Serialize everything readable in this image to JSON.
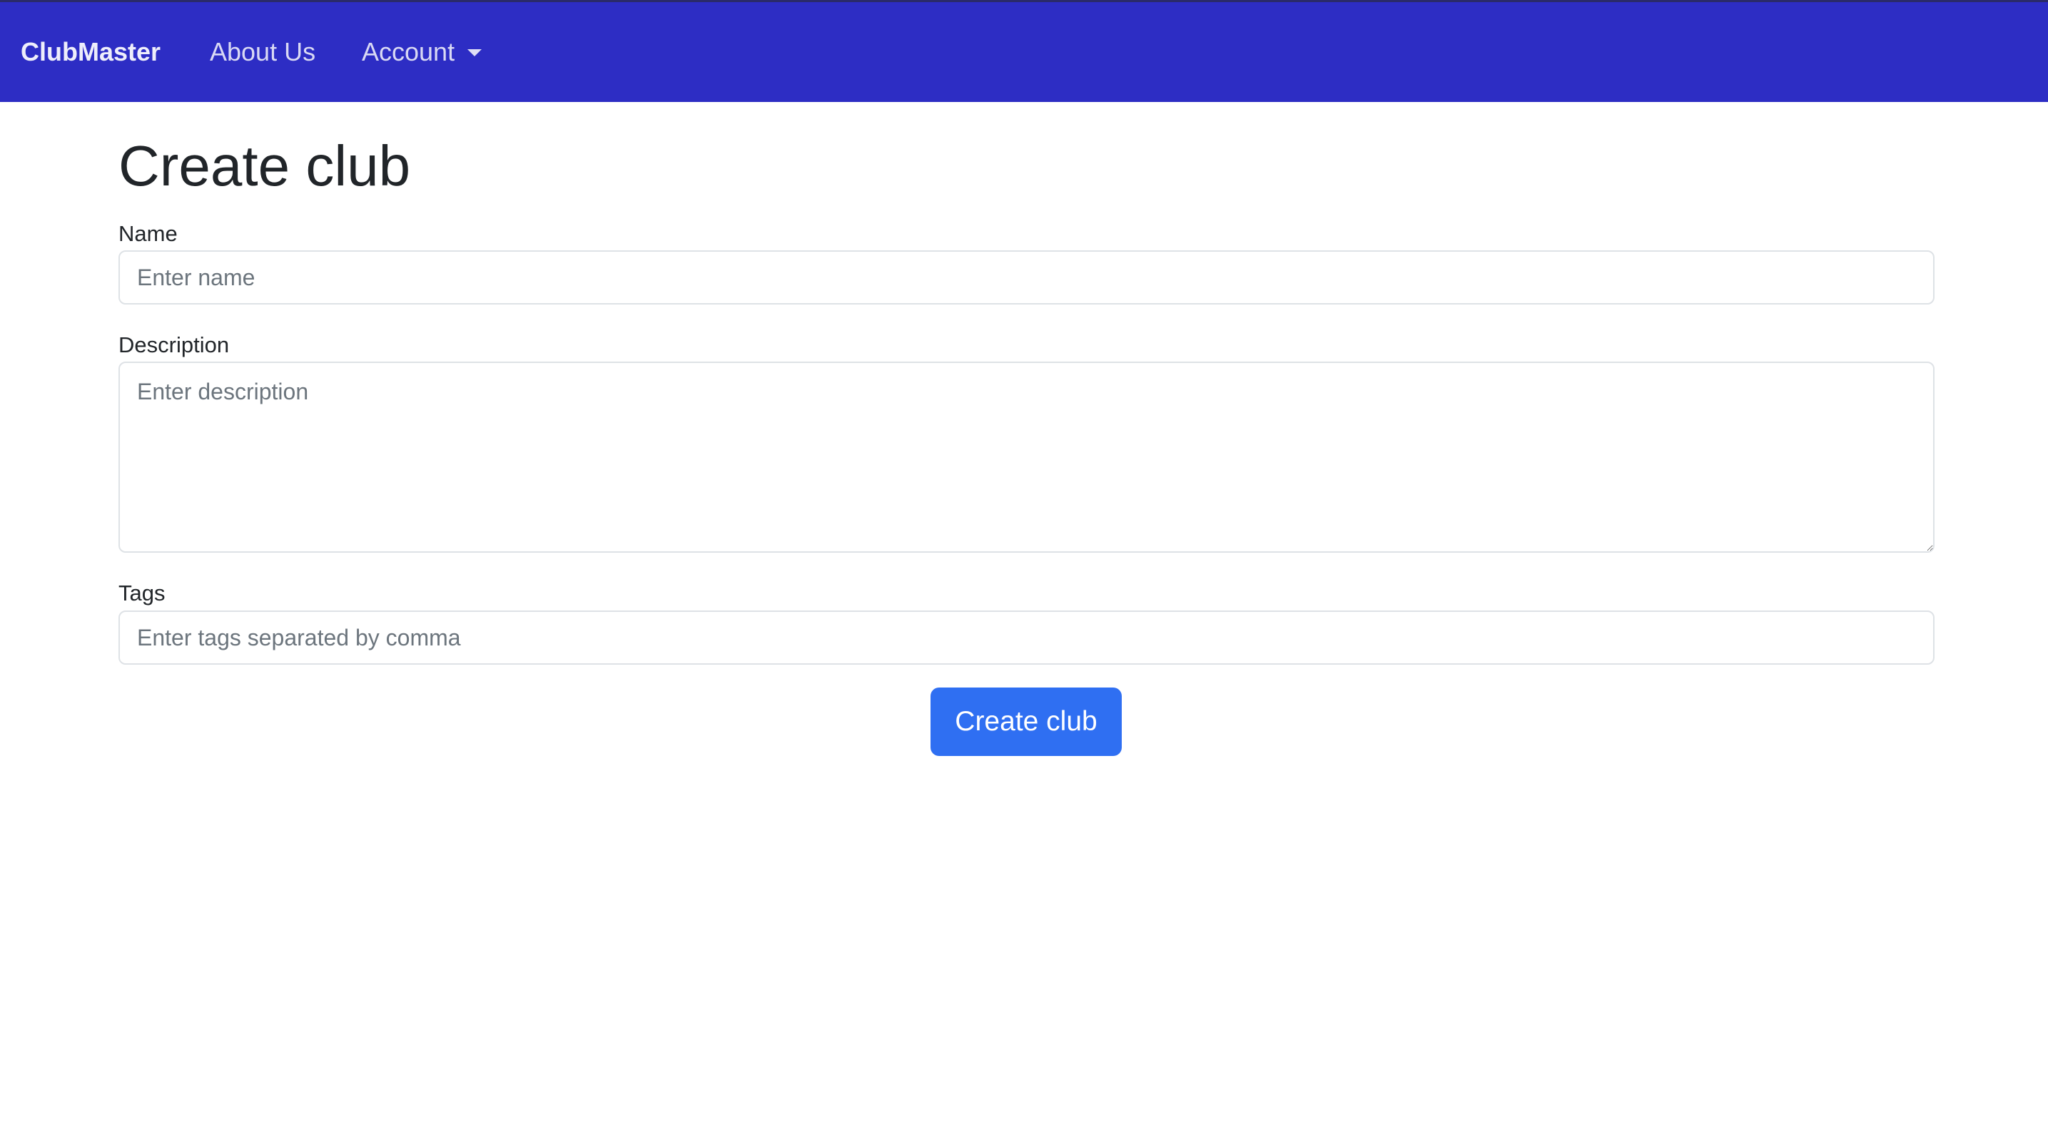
{
  "navbar": {
    "brand": "ClubMaster",
    "about_label": "About Us",
    "account_label": "Account",
    "bg_color": "#2d2dc4"
  },
  "page": {
    "title": "Create club"
  },
  "form": {
    "name_label": "Name",
    "name_placeholder": "Enter name",
    "name_value": "",
    "description_label": "Description",
    "description_placeholder": "Enter description",
    "description_value": "",
    "tags_label": "Tags",
    "tags_placeholder": "Enter tags separated by comma",
    "tags_value": "",
    "submit_label": "Create club",
    "submit_color": "#2f6ff2"
  }
}
